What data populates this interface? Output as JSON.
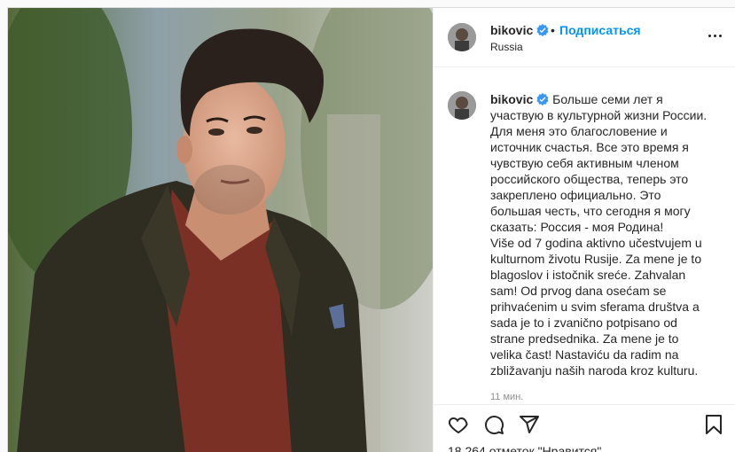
{
  "post": {
    "username": "bikovic",
    "follow_label": "Подписаться",
    "separator": "•",
    "location": "Russia",
    "caption_text": " Больше семи лет я участвую в культурной жизни России. Для меня это благословение и источник счастья. Все это время я чувствую себя активным членом российского общества, теперь это закреплено официально. Это большая честь, что сегодня я могу сказать: Россия - моя Родина!\nViše od 7 godina aktivno učestvujem u kulturnom životu Rusije. Za mene je to blagoslov i istočnik sreće. Zahvalan sam! Od prvog dana osećam se prihvaćenim u svim sferama društva a sada je to i zvanično potpisano od strane predsednika. Za mene je to velika čast! Nastaviću da radim na zbližavanju naših naroda kroz kulturu.",
    "time_ago": "11 мин.",
    "likes_text": "18 264 отметок \"Нравится\"",
    "verified": true
  },
  "icons": {
    "verified": "verified-badge-icon",
    "more": "more-options-icon",
    "like": "heart-icon",
    "comment": "comment-icon",
    "share": "paper-plane-icon",
    "save": "bookmark-icon"
  },
  "colors": {
    "link_blue": "#0095f6",
    "text": "#262626",
    "muted": "#8e8e8e",
    "border": "#dbdbdb"
  }
}
